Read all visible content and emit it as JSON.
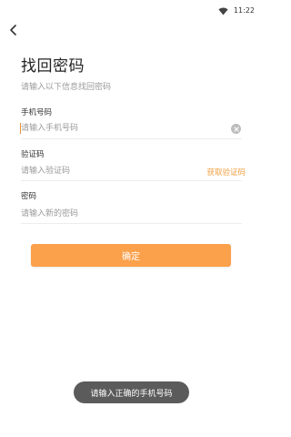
{
  "status_bar": {
    "time": "11:22",
    "wifi_icon": "wifi-icon"
  },
  "header": {
    "back_icon": "chevron-left-icon",
    "title": "找回密码",
    "subtitle": "请输入以下信息找回密码"
  },
  "form": {
    "phone": {
      "label": "手机号码",
      "value": "",
      "placeholder": "请输入手机号码",
      "clear_icon": "clear-icon"
    },
    "code": {
      "label": "验证码",
      "value": "",
      "placeholder": "请输入验证码",
      "get_code_label": "获取验证码"
    },
    "password": {
      "label": "密码",
      "value": "",
      "placeholder": "请输入新的密码"
    }
  },
  "actions": {
    "confirm_label": "确定"
  },
  "toast": {
    "message": "请输入正确的手机号码"
  },
  "colors": {
    "accent": "#fba14b",
    "link": "#f0a043",
    "toast_bg": "#5b5b5b"
  }
}
